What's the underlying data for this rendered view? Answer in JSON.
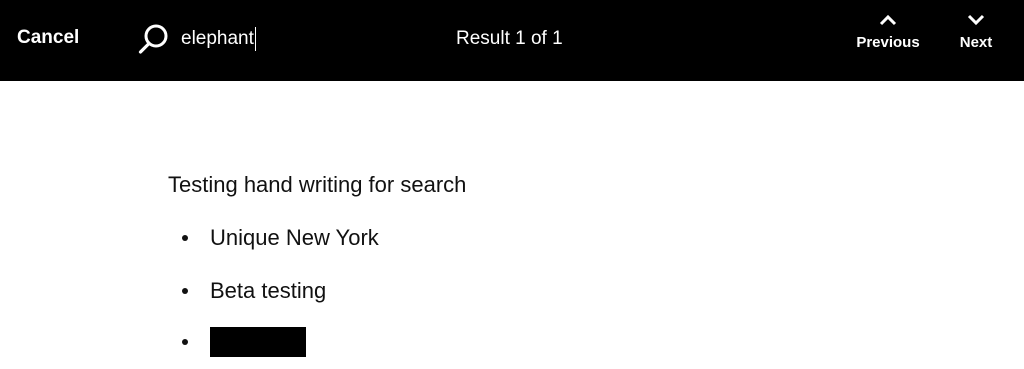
{
  "toolbar": {
    "cancel_label": "Cancel",
    "search": {
      "value": "elephant",
      "icon": "search-icon"
    },
    "result_status": "Result 1 of 1",
    "previous_label": "Previous",
    "previous_icon": "chevron-up-icon",
    "next_label": "Next",
    "next_icon": "chevron-down-icon"
  },
  "document": {
    "heading": "Testing hand writing for search",
    "bullets": [
      {
        "text": "Unique New York"
      },
      {
        "text": "Beta testing"
      },
      {
        "text": "",
        "redacted": true
      }
    ]
  },
  "colors": {
    "toolbar_background": "#000000",
    "toolbar_text": "#ffffff",
    "page_background": "#ffffff",
    "text": "#111111"
  }
}
